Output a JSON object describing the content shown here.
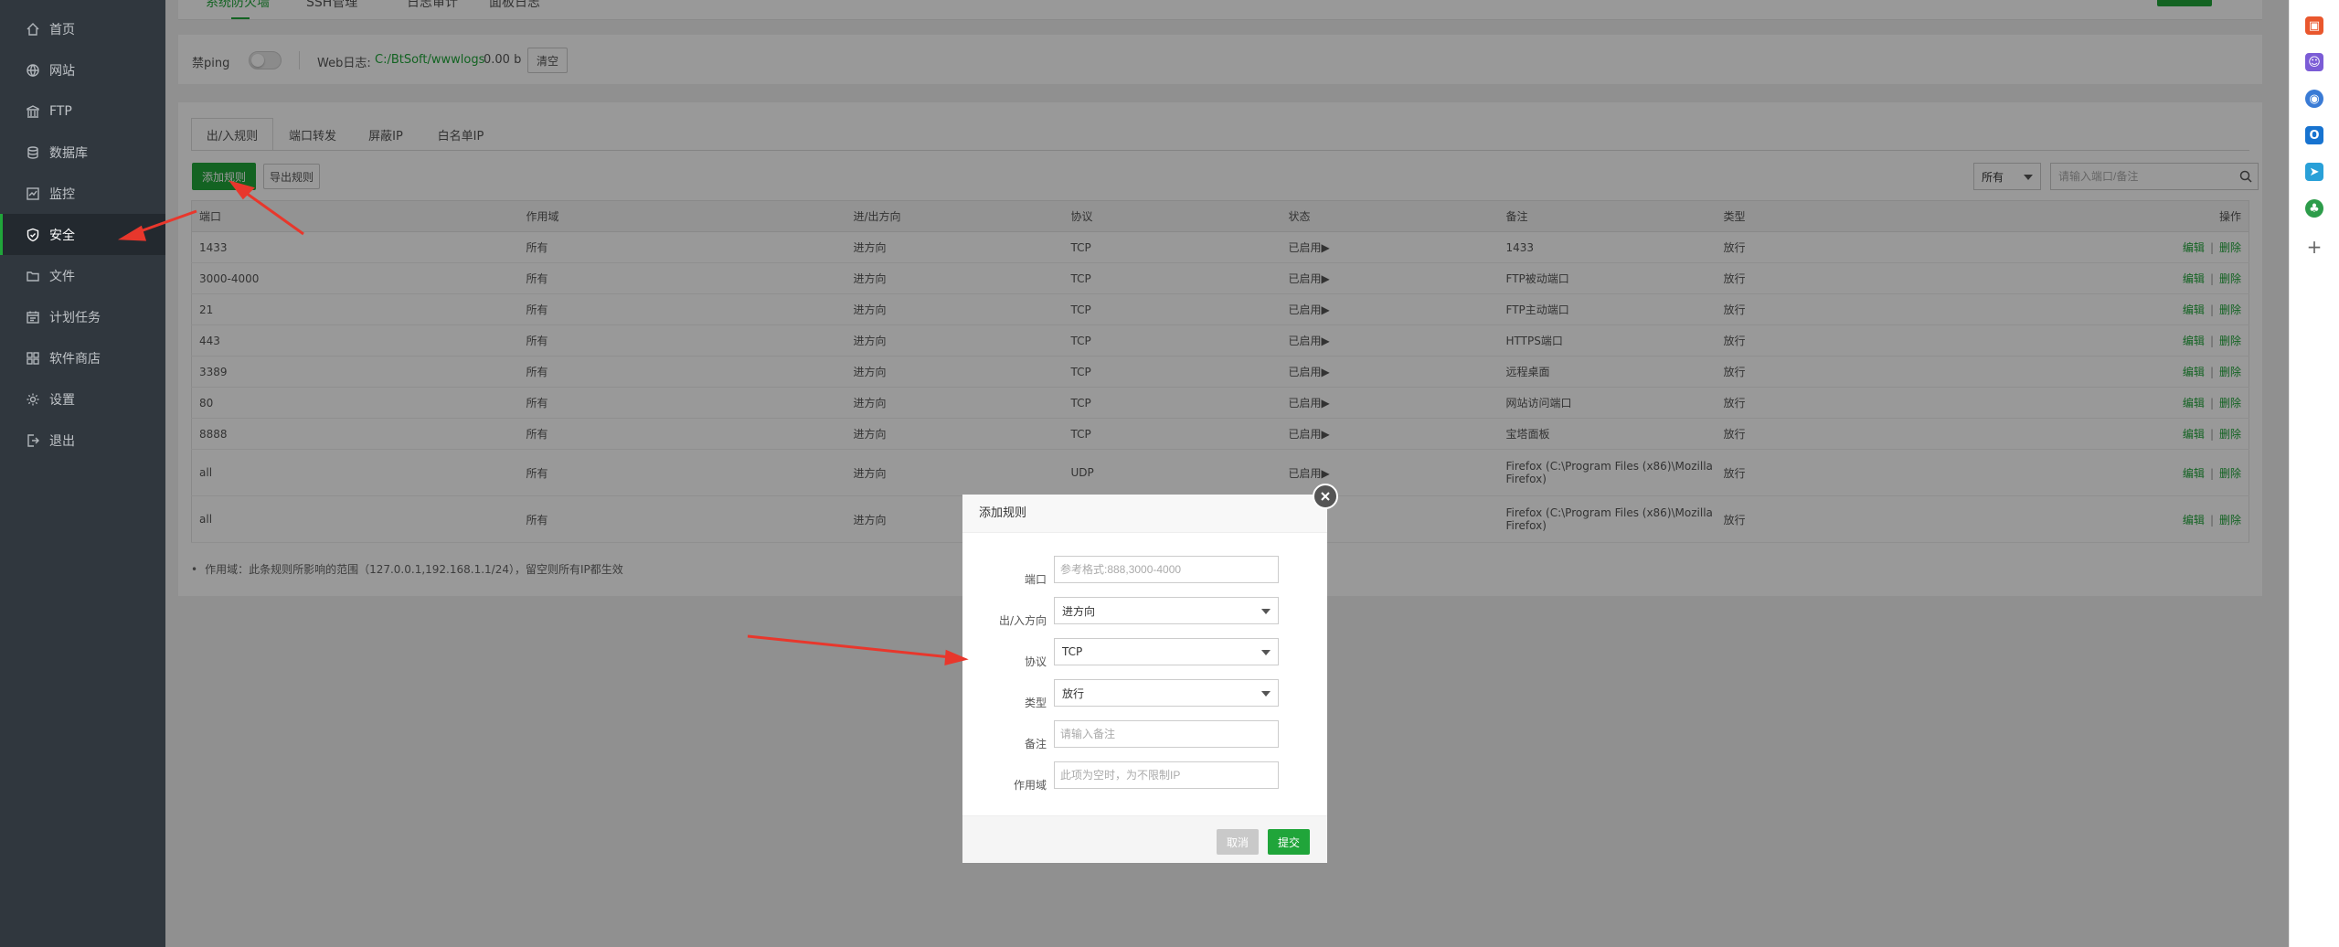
{
  "sidebar": {
    "items": [
      {
        "label": "首页",
        "icon": "home-icon"
      },
      {
        "label": "网站",
        "icon": "globe-icon"
      },
      {
        "label": "FTP",
        "icon": "ftp-icon"
      },
      {
        "label": "数据库",
        "icon": "database-icon"
      },
      {
        "label": "监控",
        "icon": "monitor-icon"
      },
      {
        "label": "安全",
        "icon": "shield-icon",
        "active": true
      },
      {
        "label": "文件",
        "icon": "folder-icon"
      },
      {
        "label": "计划任务",
        "icon": "calendar-icon"
      },
      {
        "label": "软件商店",
        "icon": "apps-icon"
      },
      {
        "label": "设置",
        "icon": "gear-icon"
      },
      {
        "label": "退出",
        "icon": "logout-icon"
      }
    ]
  },
  "top_panel": {
    "ping_label": "禁ping",
    "ping_enabled": false,
    "weblog_label": "Web日志:",
    "weblog_path": "C:/BtSoft/wwwlogs",
    "weblog_size": "0.00 b",
    "clear_button": "清空"
  },
  "firewall": {
    "tabs": [
      "出/入规则",
      "端口转发",
      "屏蔽IP",
      "白名单IP"
    ],
    "active_tab": "出/入规则",
    "add_button": "添加规则",
    "export_button": "导出规则",
    "filter_select": "所有",
    "search_placeholder": "请输入端口/备注",
    "columns": [
      "端口",
      "作用域",
      "进/出方向",
      "协议",
      "状态",
      "备注",
      "类型",
      "操作"
    ],
    "rows": [
      {
        "port": "1433",
        "scope": "所有",
        "direction": "进方向",
        "protocol": "TCP",
        "status": "已启用▶",
        "remark": "1433",
        "type": "放行"
      },
      {
        "port": "3000-4000",
        "scope": "所有",
        "direction": "进方向",
        "protocol": "TCP",
        "status": "已启用▶",
        "remark": "FTP被动端口",
        "type": "放行"
      },
      {
        "port": "21",
        "scope": "所有",
        "direction": "进方向",
        "protocol": "TCP",
        "status": "已启用▶",
        "remark": "FTP主动端口",
        "type": "放行"
      },
      {
        "port": "443",
        "scope": "所有",
        "direction": "进方向",
        "protocol": "TCP",
        "status": "已启用▶",
        "remark": "HTTPS端口",
        "type": "放行"
      },
      {
        "port": "3389",
        "scope": "所有",
        "direction": "进方向",
        "protocol": "TCP",
        "status": "已启用▶",
        "remark": "远程桌面",
        "type": "放行"
      },
      {
        "port": "80",
        "scope": "所有",
        "direction": "进方向",
        "protocol": "TCP",
        "status": "已启用▶",
        "remark": "网站访问端口",
        "type": "放行"
      },
      {
        "port": "8888",
        "scope": "所有",
        "direction": "进方向",
        "protocol": "TCP",
        "status": "已启用▶",
        "remark": "宝塔面板",
        "type": "放行"
      },
      {
        "port": "all",
        "scope": "所有",
        "direction": "进方向",
        "protocol": "UDP",
        "status": "已启用▶",
        "remark": "Firefox (C:\\Program Files (x86)\\Mozilla Firefox)",
        "type": "放行"
      },
      {
        "port": "all",
        "scope": "所有",
        "direction": "进方向",
        "protocol": "",
        "status": "",
        "remark": "Firefox (C:\\Program Files (x86)\\Mozilla Firefox)",
        "type": "放行"
      }
    ],
    "op_edit": "编辑",
    "op_sep": "|",
    "op_delete": "删除",
    "note": "作用域：此条规则所影响的范围（127.0.0.1,192.168.1.1/24），留空则所有IP都生效"
  },
  "dialog": {
    "title": "添加规则",
    "port_label": "端口",
    "port_placeholder": "参考格式:888,3000-4000",
    "direction_label": "出/入方向",
    "direction_value": "进方向",
    "protocol_label": "协议",
    "protocol_value": "TCP",
    "type_label": "类型",
    "type_value": "放行",
    "remark_label": "备注",
    "remark_placeholder": "请输入备注",
    "scope_label": "作用域",
    "scope_placeholder": "此项为空时，为不限制IP",
    "cancel_button": "取消",
    "submit_button": "提交"
  },
  "colors": {
    "accent": "#20a53a",
    "sidebar_bg": "#30373e",
    "arrow": "#e8372c"
  }
}
